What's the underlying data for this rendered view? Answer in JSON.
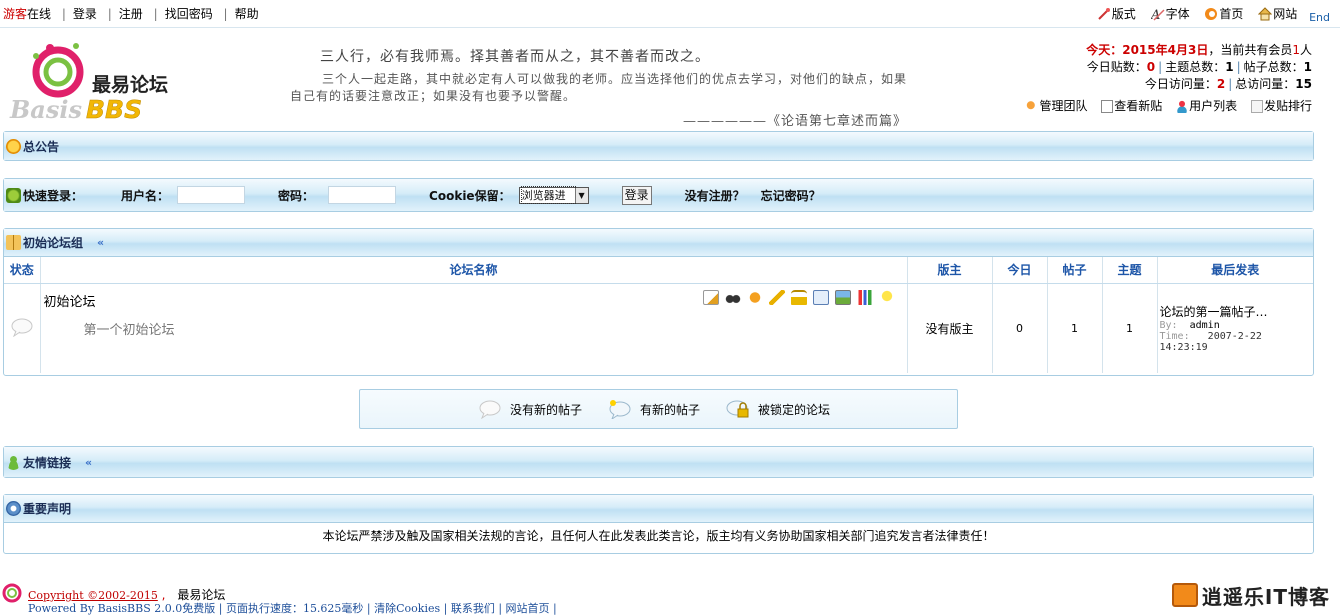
{
  "topbar": {
    "guest_prefix": "游客",
    "guest_suffix": "在线",
    "links": [
      "登录",
      "注册",
      "找回密码",
      "帮助"
    ],
    "right_items": [
      {
        "icon": "style-icon",
        "label": "版式"
      },
      {
        "icon": "font-icon",
        "label": "字体"
      },
      {
        "icon": "home-icon",
        "label": "首页"
      },
      {
        "icon": "website-icon",
        "label": "网站"
      }
    ],
    "end_label": "End"
  },
  "header": {
    "logo_brand": "最易论坛",
    "logo_sub1": "Basis",
    "logo_sub2": "BBS",
    "quote_title": "三人行，必有我师焉。择其善者而从之，其不善者而改之。",
    "quote_body": "三个人一起走路，其中就必定有人可以做我的老师。应当选择他们的优点去学习，对他们的缺点，如果自己有的话要注意改正；如果没有也要予以警醒。",
    "quote_source": "——————《论语第七章述而篇》",
    "stats": {
      "today_label": "今天：",
      "today_date": "2015年4月3日",
      "members_prefix": "，当前共有会员",
      "members_count": "1",
      "members_suffix": "人",
      "posts_today_label": "今日贴数：",
      "posts_today": "0",
      "topics_total_label": "主题总数：",
      "topics_total": "1",
      "posts_total_label": "帖子总数：",
      "posts_total": "1",
      "visits_today_label": "今日访问量：",
      "visits_today": "2",
      "visits_total_label": "总访问量：",
      "visits_total": "15"
    },
    "links": [
      {
        "icon": "team-icon",
        "label": "管理团队"
      },
      {
        "icon": "new-posts-icon",
        "label": "查看新贴"
      },
      {
        "icon": "user-list-icon",
        "label": "用户列表"
      },
      {
        "icon": "ranking-icon",
        "label": "发贴排行"
      }
    ]
  },
  "announcement": {
    "title": "总公告"
  },
  "quick_login": {
    "title": "快速登录：",
    "username_label": "用户名：",
    "password_label": "密码：",
    "cookie_label": "Cookie保留：",
    "cookie_option": "浏览器进",
    "login_button": "登录",
    "register_link": "没有注册？",
    "forgot_link": "忘记密码？"
  },
  "forum_group": {
    "title": "初始论坛组",
    "columns": [
      "状态",
      "论坛名称",
      "版主",
      "今日",
      "帖子",
      "主题",
      "最后发表"
    ],
    "forums": [
      {
        "name": "初始论坛",
        "description": "第一个初始论坛",
        "moderator": "没有版主",
        "today": "0",
        "posts": "1",
        "topics": "1",
        "last_title": "论坛的第一篇帖子…",
        "last_by_label": "By:",
        "last_by": "admin",
        "last_time_label": "Time:",
        "last_time": "2007-2-22 14:23:19"
      }
    ]
  },
  "legend": [
    {
      "icon": "no-new-posts-icon",
      "label": "没有新的帖子"
    },
    {
      "icon": "new-posts-bubble-icon",
      "label": "有新的帖子"
    },
    {
      "icon": "locked-forum-icon",
      "label": "被锁定的论坛"
    }
  ],
  "friend_links": {
    "title": "友情链接"
  },
  "declaration": {
    "title": "重要声明",
    "text": "本论坛严禁涉及触及国家相关法规的言论，且任何人在此发表此类言论，版主均有义务协助国家相关部门追究发言者法律责任！"
  },
  "footer": {
    "copyright": "Copyright ©2002-2015",
    "site_name": "最易论坛",
    "line2": "Powered By BasisBBS 2.0.0免费版 | 页面执行速度：15.625毫秒 | 清除Cookies | 联系我们 | 网站首页 |",
    "watermark": "逍遥乐IT博客"
  }
}
